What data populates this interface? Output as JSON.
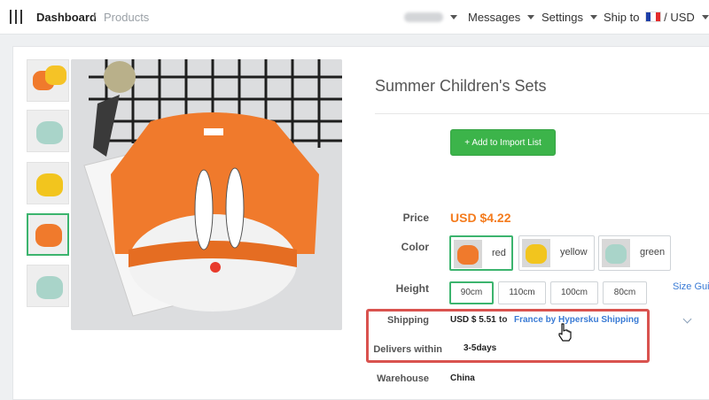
{
  "topbar": {
    "breadcrumb": {
      "home": "Dashboard",
      "separator": "/",
      "current": "Products"
    },
    "nav": {
      "messages": "Messages",
      "settings": "Settings",
      "ship_to": "Ship to",
      "currency": "/ USD"
    }
  },
  "product": {
    "title": "Summer Children's Sets",
    "import_button": "+ Add to Import List",
    "price_label": "Price",
    "price": "USD $4.22",
    "color_label": "Color",
    "colors": [
      {
        "label": "red",
        "selected": true
      },
      {
        "label": "yellow",
        "selected": false
      },
      {
        "label": "green",
        "selected": false
      }
    ],
    "height_label": "Height",
    "heights": [
      {
        "label": "90cm",
        "selected": true
      },
      {
        "label": "110cm",
        "selected": false
      },
      {
        "label": "100cm",
        "selected": false
      },
      {
        "label": "80cm",
        "selected": false
      }
    ],
    "size_guide": "Size Gui",
    "shipping_label": "Shipping",
    "shipping_cost": "USD $ 5.51",
    "shipping_to": "to",
    "shipping_method": "France by Hypersku Shipping",
    "delivers_label": "Delivers within",
    "delivers_value": "3-5days",
    "warehouse_label": "Warehouse",
    "warehouse_value": "China"
  },
  "colors": {
    "accent_green": "#3cb44a",
    "price_orange": "#f47b1d",
    "link_blue": "#3a7bd5",
    "highlight_red": "#d9534f"
  }
}
